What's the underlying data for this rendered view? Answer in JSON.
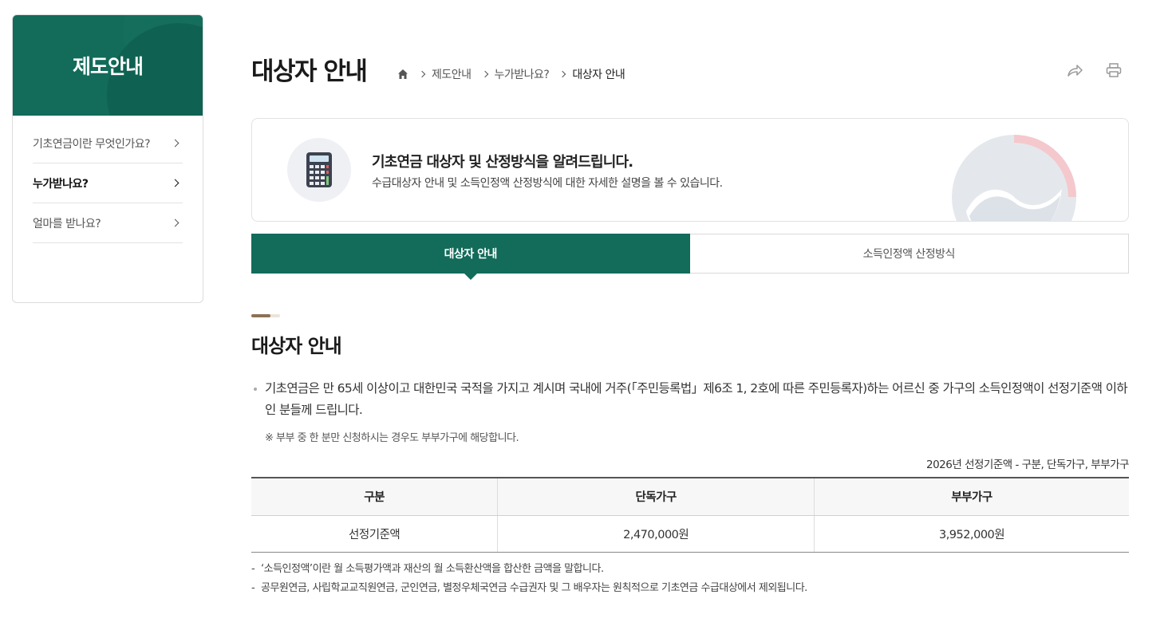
{
  "sidebar": {
    "title": "제도안내",
    "items": [
      {
        "label": "기초연금이란 무엇인가요?"
      },
      {
        "label": "누가받나요?"
      },
      {
        "label": "얼마를 받나요?"
      }
    ]
  },
  "header": {
    "title": "대상자 안내",
    "breadcrumb": [
      "제도안내",
      "누가받나요?",
      "대상자 안내"
    ]
  },
  "info": {
    "title": "기초연금 대상자 및 산정방식을 알려드립니다.",
    "description": "수급대상자 안내 및 소득인정액 산정방식에 대한 자세한 설명을 볼 수 있습니다."
  },
  "tabs": [
    {
      "label": "대상자 안내",
      "active": true
    },
    {
      "label": "소득인정액 산정방식",
      "active": false
    }
  ],
  "section": {
    "title": "대상자 안내",
    "paragraph": "기초연금은 만 65세 이상이고 대한민국 국적을 가지고 계시며 국내에 거주(「주민등록법」제6조 1, 2호에 따른 주민등록자)하는 어르신 중 가구의 소득인정액이 선정기준액 이하인 분들께 드립니다.",
    "note": "※ 부부 중 한 분만 신청하시는 경우도 부부가구에 해당합니다.",
    "table_caption": "2026년 선정기준액 - 구분, 단독가구, 부부가구",
    "table": {
      "headers": [
        "구분",
        "단독가구",
        "부부가구"
      ],
      "rows": [
        [
          "선정기준액",
          "2,470,000원",
          "3,952,000원"
        ]
      ]
    },
    "footnotes": [
      "‘소득인정액’이란 월 소득평가액과 재산의 월 소득환산액을 합산한 금액을 말합니다.",
      "공무원연금, 사립학교교직원연금, 군인연금, 별정우체국연금 수급권자 및 그 배우자는 원칙적으로 기초연금 수급대상에서 제외됩니다."
    ]
  },
  "colors": {
    "brand_green": "#136b5a",
    "section_accent": "#8b7156"
  },
  "icons": {
    "home": "home-icon",
    "share": "share-icon",
    "print": "print-icon",
    "calculator": "calculator-icon",
    "emblem": "government-emblem-icon"
  }
}
